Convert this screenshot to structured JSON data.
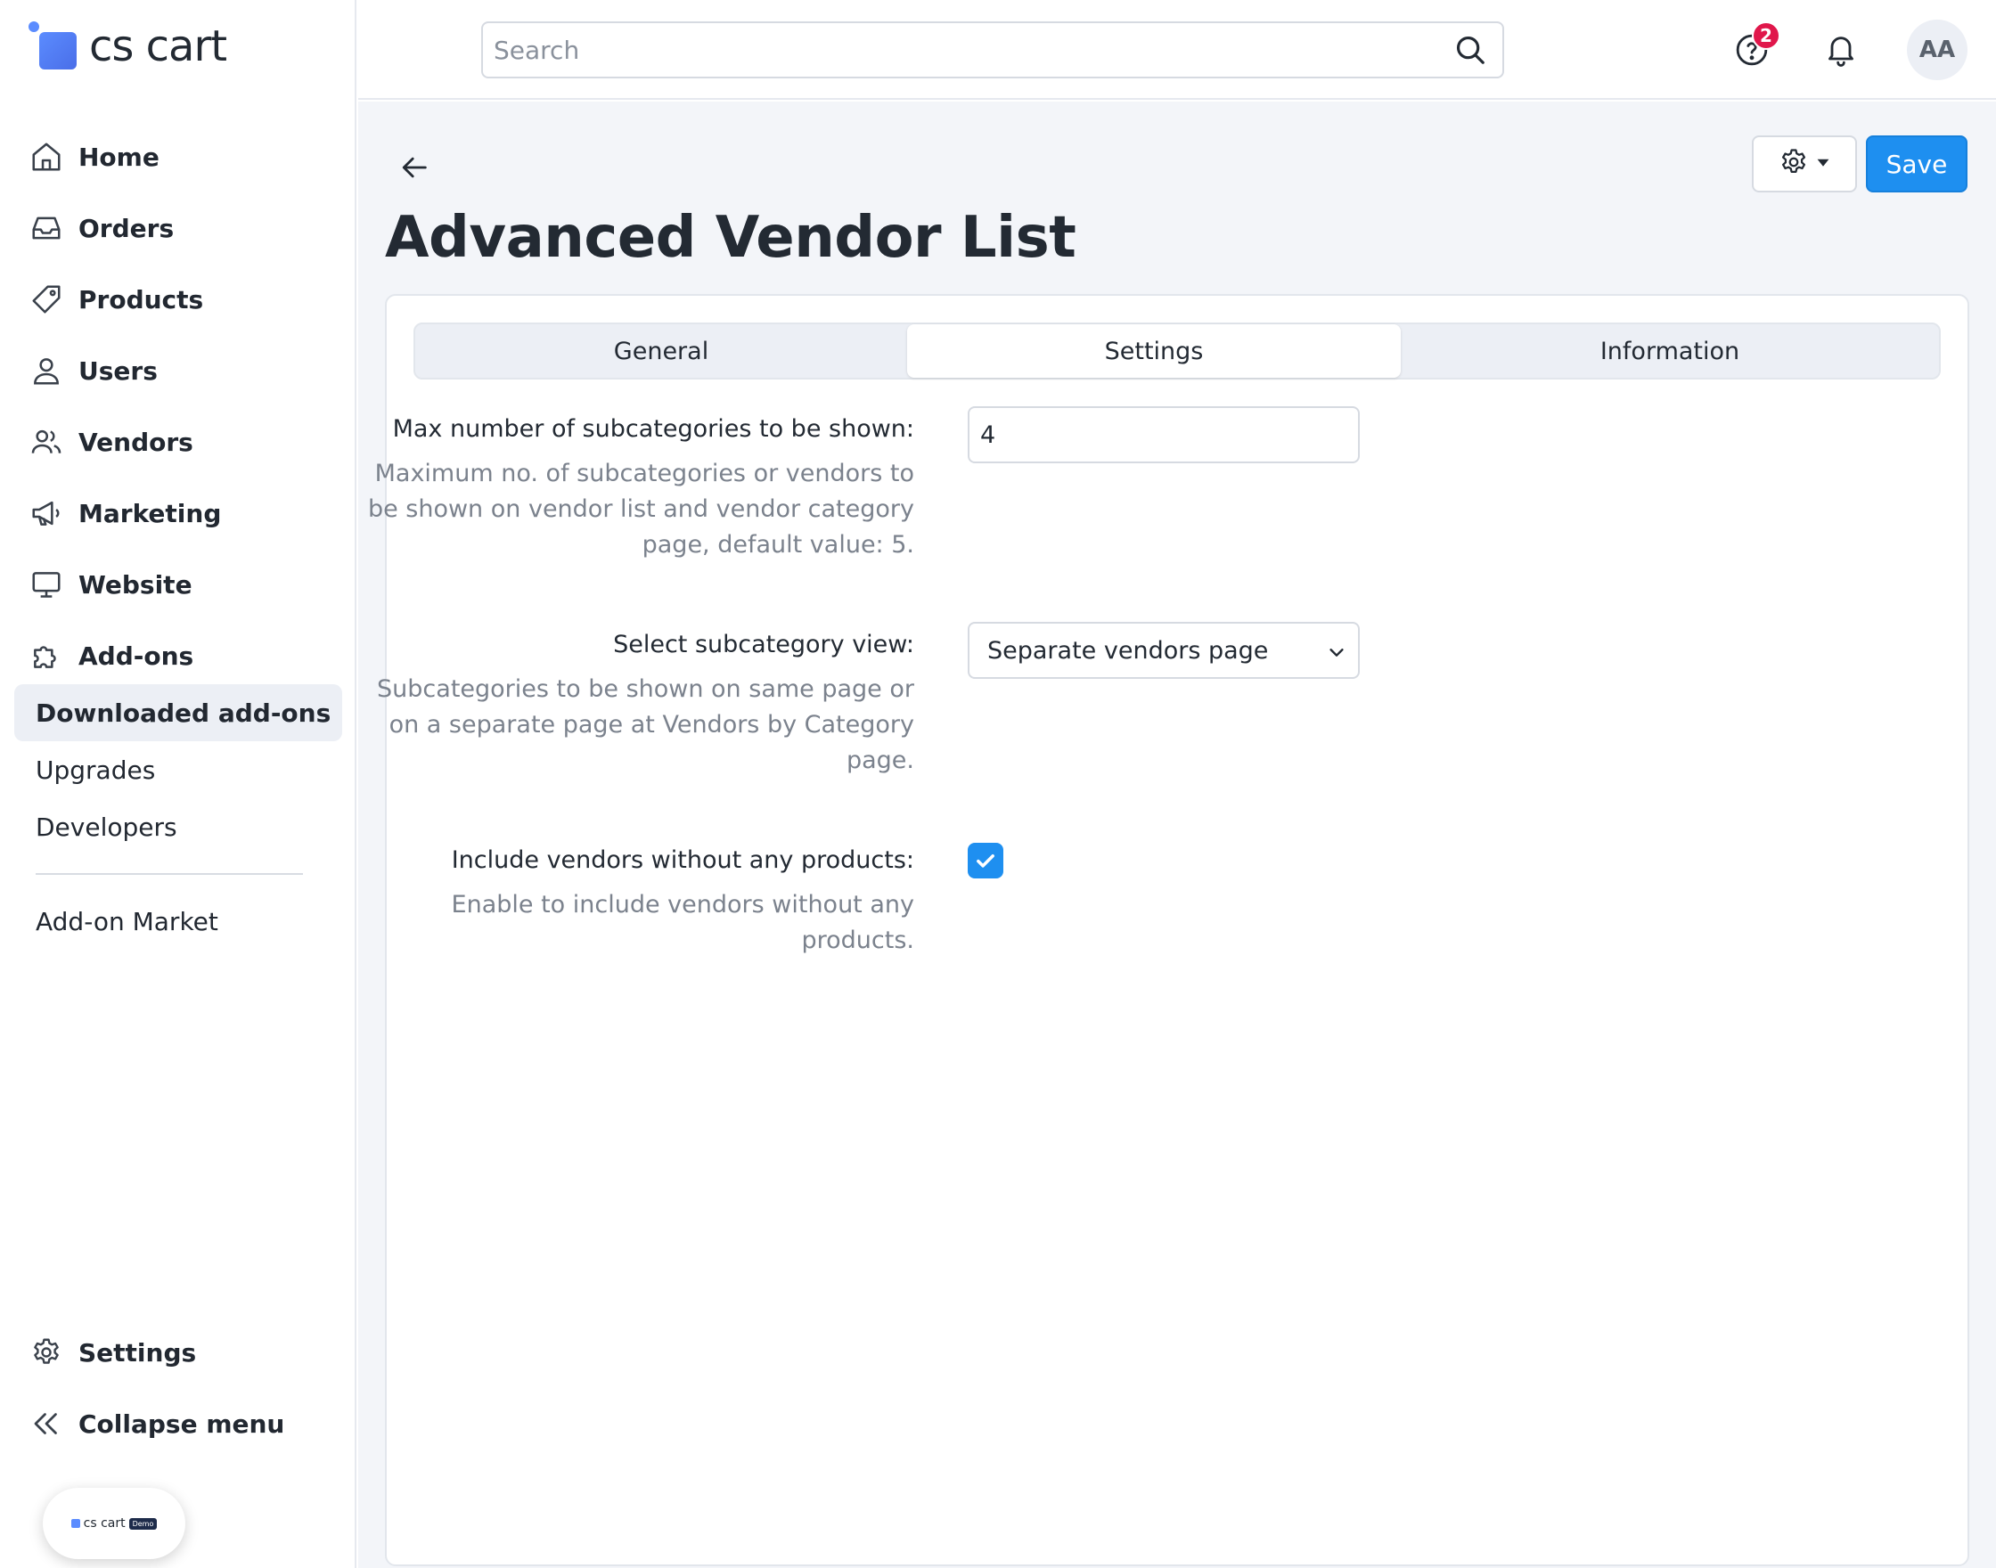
{
  "app": {
    "logo_text": "cs cart",
    "accent_color": "#1e8ff0",
    "demo_badge_text": "cs cart",
    "demo_badge_tag": "Demo"
  },
  "sidebar": {
    "items": [
      {
        "label": "Home",
        "icon": "home-icon"
      },
      {
        "label": "Orders",
        "icon": "inbox-icon"
      },
      {
        "label": "Products",
        "icon": "tag-icon"
      },
      {
        "label": "Users",
        "icon": "user-icon"
      },
      {
        "label": "Vendors",
        "icon": "users-icon"
      },
      {
        "label": "Marketing",
        "icon": "megaphone-icon"
      },
      {
        "label": "Website",
        "icon": "monitor-icon"
      },
      {
        "label": "Add-ons",
        "icon": "puzzle-icon"
      }
    ],
    "sub_items": [
      {
        "label": "Downloaded add-ons",
        "active": true
      },
      {
        "label": "Upgrades"
      },
      {
        "label": "Developers"
      },
      {
        "label": "Add-on Market"
      }
    ],
    "bottom_items": [
      {
        "label": "Settings",
        "icon": "gear-icon"
      },
      {
        "label": "Collapse menu",
        "icon": "chevrons-left-icon"
      }
    ]
  },
  "header": {
    "search_placeholder": "Search",
    "help_badge_count": "2",
    "avatar_initials": "AA"
  },
  "page": {
    "title": "Advanced Vendor List",
    "save_label": "Save",
    "tabs": [
      {
        "label": "General"
      },
      {
        "label": "Settings",
        "active": true
      },
      {
        "label": "Information"
      }
    ],
    "fields": [
      {
        "label": "Max number of subcategories to be shown:",
        "help": "Maximum no. of subcategories or vendors to be shown on vendor list and vendor category page, default value: 5.",
        "value": "4"
      },
      {
        "label": "Select subcategory view:",
        "help": "Subcategories to be shown on same page or on a separate page at Vendors by Category page.",
        "selected": "Separate vendors page"
      },
      {
        "label": "Include vendors without any products:",
        "help": "Enable to include vendors without any products.",
        "checked": true
      }
    ]
  }
}
